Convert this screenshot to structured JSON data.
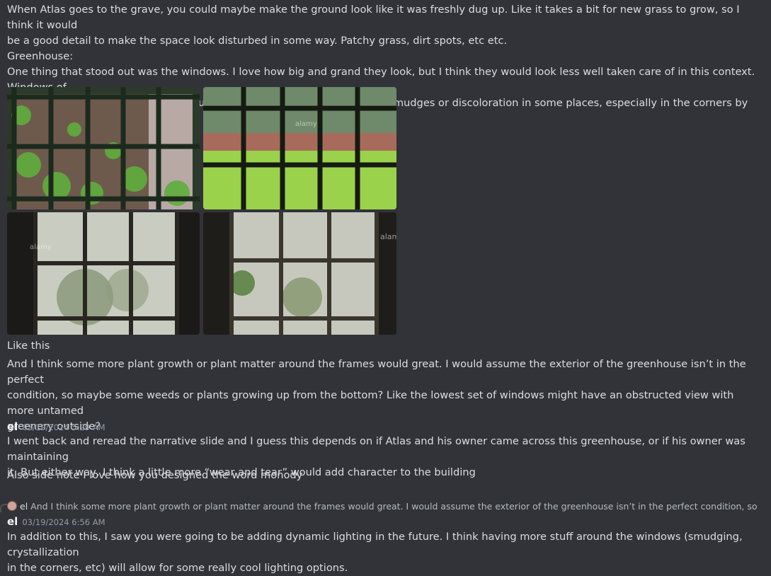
{
  "message1": {
    "lines": [
      "When Atlas goes to the grave, you could maybe make the ground look like it was freshly dug up. Like it takes a bit for new grass to grow, so I think it would",
      "be a good detail to make the space look disturbed in some way. Patchy grass, dirt spots, etc etc.",
      "Greenhouse:",
      "One thing that stood out was the windows. I love how big and grand they look, but I think they would look less well taken care of in this context. Windows of",
      "abandoned buildings tend to be in rough shape, whether that’s cracks or smudges or discoloration in some places, especially in the corners by the framing"
    ],
    "after_images": [
      "Like this",
      "And I think some more plant growth or plant matter around the frames would great. I would assume the exterior of the greenhouse isn’t in the perfect",
      "condition, so maybe some weeds or plants growing up from the bottom? Like the lowest set of windows might have an obstructed view with more untamed",
      "greenery outside?"
    ],
    "watermark": "alamy"
  },
  "message2": {
    "author": "el",
    "timestamp": "03/19/2024 5:29 AM",
    "lines": [
      "I went back and reread the narrative slide and I guess this depends on if Atlas and his owner came across this greenhouse, or if his owner was maintaining",
      "it. But either way, I think a little more “wear and tear” would add character to the building",
      "Also side note I love how you designed the word monody"
    ]
  },
  "reply": {
    "author": "el",
    "text": "And I think some more plant growth or plant matter around the frames would great. I would assume the exterior of the greenhouse isn’t in the perfect condition, so maybe sc"
  },
  "message3": {
    "author": "el",
    "timestamp": "03/19/2024 6:56 AM",
    "lines": [
      "In addition to this, I saw you were going to be adding dynamic lighting in the future. I think having more stuff around the windows (smudging, crystallization",
      "in the corners, etc) will allow for some really cool lighting options."
    ]
  },
  "colors": {
    "background": "#313338",
    "text": "#dbdee1",
    "timestamp": "#949ba4"
  }
}
